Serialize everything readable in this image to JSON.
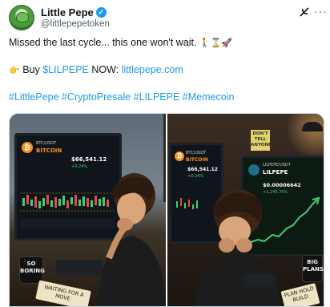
{
  "author": {
    "name": "Little Pepe",
    "handle": "@littlepepetoken",
    "verified_glyph": "✓"
  },
  "header_icons": {
    "grok": "grok-icon",
    "more": "···"
  },
  "tweet": {
    "line1": "Missed the last cycle... this one won't wait.",
    "line1_emoji": "🚶⌛🚀",
    "line2_emoji": "👉",
    "line2_prefix": "Buy ",
    "line2_ticker": "$LILPEPE",
    "line2_mid": " NOW: ",
    "line2_link": "littlepepe.com",
    "hashtags": "#LittlePepe #CryptoPresale #LILPEPE #Memecoin"
  },
  "media": {
    "left": {
      "coin_glyph": "₿",
      "ticker": "BTC/USDT",
      "coin_name": "BITCOIN",
      "price": "$66,541.12",
      "change": "+0.24%",
      "mug_text": "SO BORING",
      "note_text": "WAITING FOR A MOVE"
    },
    "right": {
      "coin_glyph": "₿",
      "ticker": "BTC/USDT",
      "coin_name": "BITCOIN",
      "price": "$66,541.12",
      "change": "+0.24%",
      "pepe_name": "LILPEPE",
      "pepe_ticker": "LILPEPE/USDT",
      "pepe_price": "$0.00006642",
      "pepe_change": "+1,245.70%",
      "sticky_text": "DON'T TELL ANYONE",
      "mug_text": "BIG PLANS",
      "note_text": "PLAN HOLD BUILD"
    }
  },
  "colors": {
    "accent": "#1d9bf0",
    "bitcoin": "#f7931a",
    "bull_green": "#3bd16f",
    "bear_red": "#e5484d"
  }
}
